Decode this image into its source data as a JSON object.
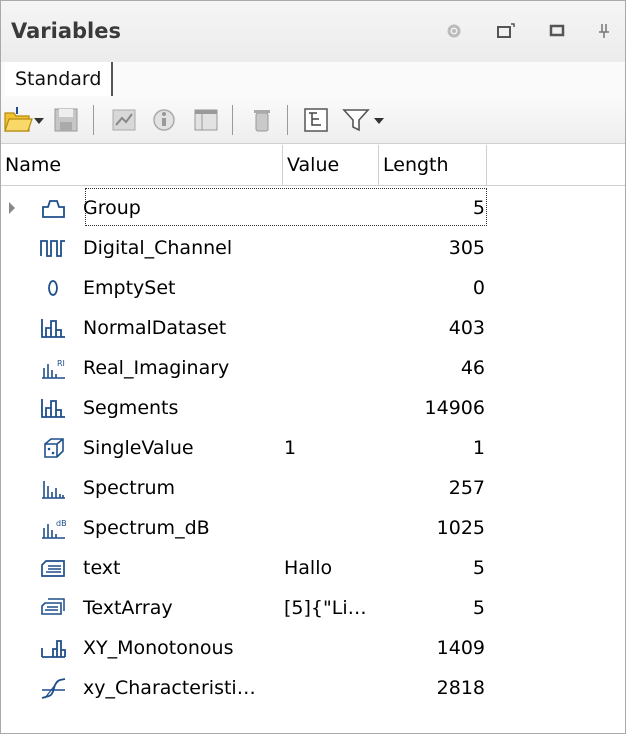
{
  "panel": {
    "title": "Variables",
    "title_buttons": [
      "gear-icon",
      "float-icon",
      "maximize-icon",
      "pin-icon"
    ]
  },
  "tabs": [
    {
      "label": "Standard",
      "active": true
    }
  ],
  "toolbar": {
    "buttons": [
      "open-folder-icon",
      "dropdown-arrow-icon",
      "save-icon",
      "chart-icon",
      "info-icon",
      "table-icon",
      "delete-icon",
      "tree-icon",
      "filter-icon",
      "dropdown-arrow-icon"
    ]
  },
  "table": {
    "columns": {
      "name": "Name",
      "value": "Value",
      "length": "Length"
    },
    "rows": [
      {
        "icon": "group-icon",
        "name": "Group",
        "value": "",
        "length": "5",
        "expandable": true,
        "focused": true
      },
      {
        "icon": "digital-channel-icon",
        "name": "Digital_Channel",
        "value": "",
        "length": "305"
      },
      {
        "icon": "emptyset-icon",
        "name": "EmptySet",
        "value": "",
        "length": "0"
      },
      {
        "icon": "dataset-icon",
        "name": "NormalDataset",
        "value": "",
        "length": "403"
      },
      {
        "icon": "real-imaginary-icon",
        "name": "Real_Imaginary",
        "value": "",
        "length": "46"
      },
      {
        "icon": "dataset-icon",
        "name": "Segments",
        "value": "",
        "length": "14906"
      },
      {
        "icon": "single-value-icon",
        "name": "SingleValue",
        "value": "1",
        "length": "1"
      },
      {
        "icon": "spectrum-icon",
        "name": "Spectrum",
        "value": "",
        "length": "257"
      },
      {
        "icon": "spectrum-db-icon",
        "name": "Spectrum_dB",
        "value": "",
        "length": "1025"
      },
      {
        "icon": "text-icon",
        "name": "text",
        "value": "Hallo",
        "length": "5"
      },
      {
        "icon": "text-array-icon",
        "name": "TextArray",
        "value": "[5]{\"Li…",
        "length": "5"
      },
      {
        "icon": "xy-monotonous-icon",
        "name": "XY_Monotonous",
        "value": "",
        "length": "1409"
      },
      {
        "icon": "xy-characteristic-icon",
        "name": "xy_Characteristi…",
        "value": "",
        "length": "2818"
      }
    ]
  },
  "colors": {
    "icon_blue": "#1f4f8a",
    "folder_yellow": "#f2c230"
  }
}
